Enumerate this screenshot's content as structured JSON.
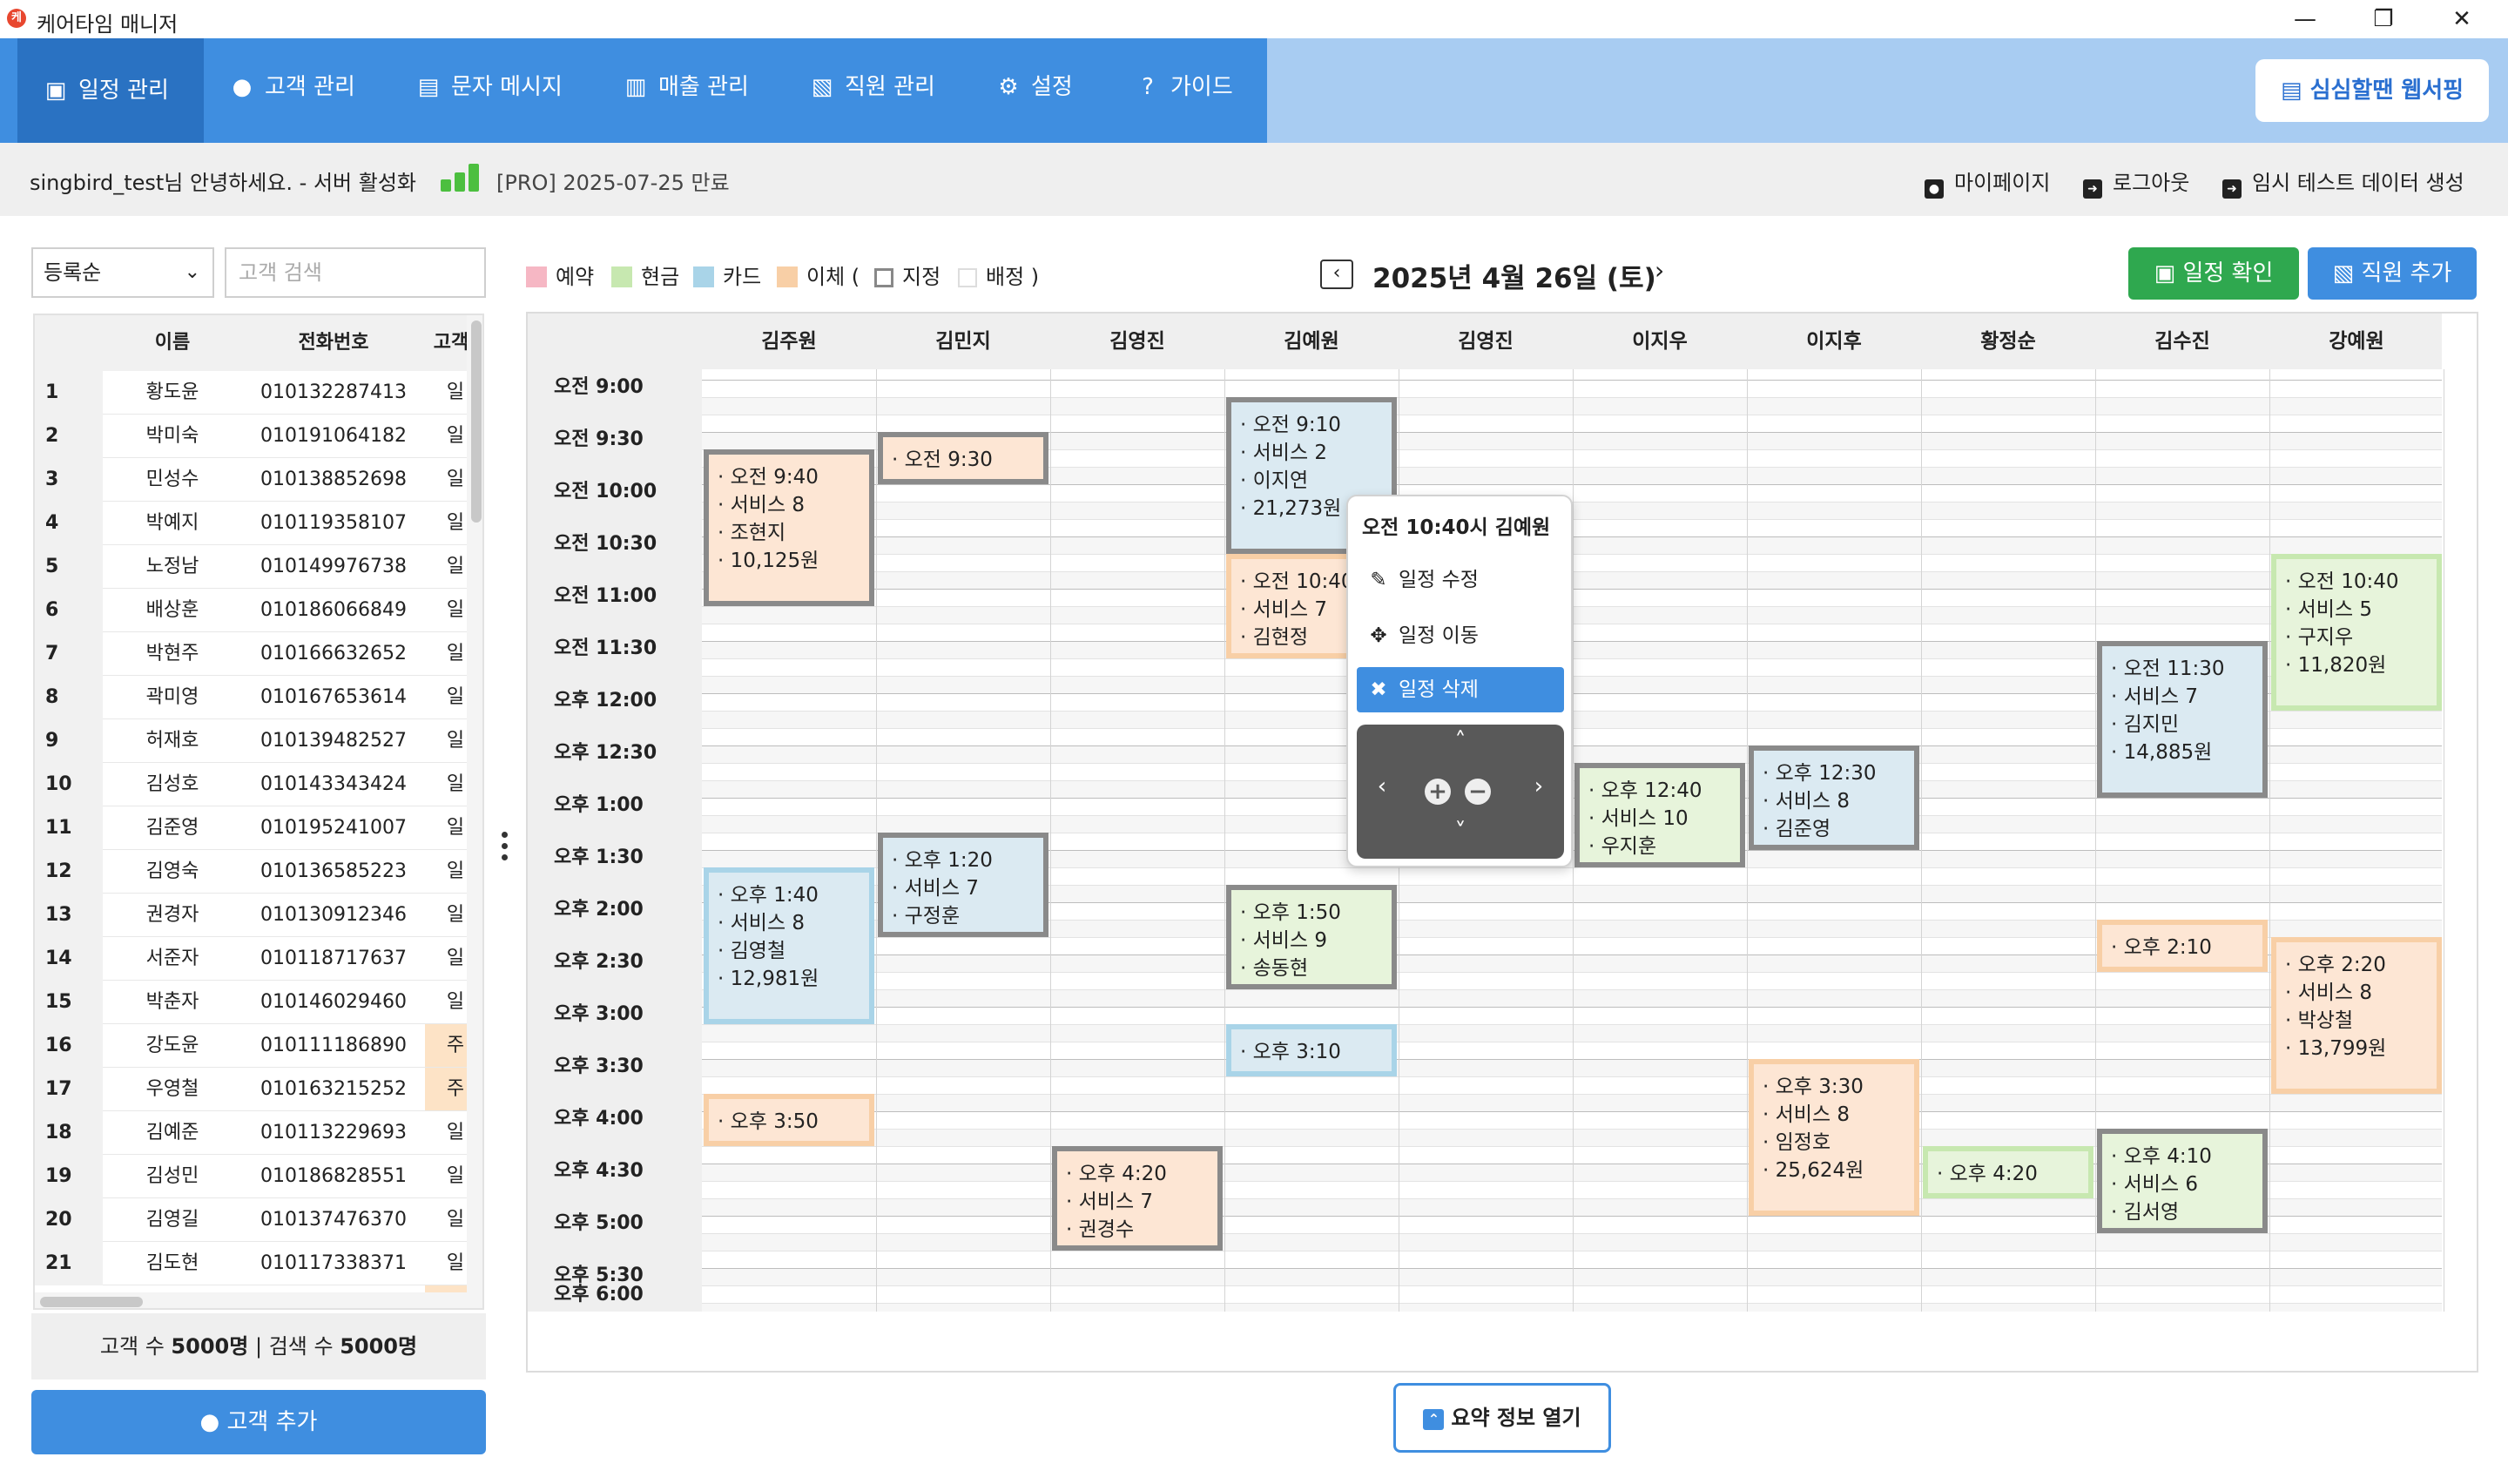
{
  "window": {
    "title": "케어타임 매니저",
    "logo": "케",
    "minimize": "—",
    "maximize": "❐",
    "close": "✕"
  },
  "nav": {
    "tabs": [
      {
        "label": "일정 관리",
        "icon": "calendar-icon",
        "glyph": "▣"
      },
      {
        "label": "고객 관리",
        "icon": "person-icon",
        "glyph": "👤"
      },
      {
        "label": "문자 메시지",
        "icon": "message-icon",
        "glyph": "▤"
      },
      {
        "label": "매출 관리",
        "icon": "document-icon",
        "glyph": "▥"
      },
      {
        "label": "직원 관리",
        "icon": "id-card-icon",
        "glyph": "▧"
      },
      {
        "label": "설정",
        "icon": "gear-icon",
        "glyph": "⚙"
      },
      {
        "label": "가이드",
        "icon": "question-icon",
        "glyph": "?"
      }
    ],
    "web_button": "심심할땐 웹서핑"
  },
  "status": {
    "greeting": "singbird_test님 안녕하세요. - 서버 활성화",
    "plan": "[PRO] 2025-07-25 만료",
    "mypage": "마이페이지",
    "logout": "로그아웃",
    "test_data": "임시 테스트 데이터 생성"
  },
  "customers": {
    "sort_value": "등록순",
    "search_placeholder": "고객 검색",
    "headers": {
      "name": "이름",
      "phone": "전화번호",
      "type": "고객"
    },
    "rows": [
      {
        "idx": "1",
        "name": "황도윤",
        "phone": "010132287413",
        "type": "일"
      },
      {
        "idx": "2",
        "name": "박미숙",
        "phone": "010191064182",
        "type": "일"
      },
      {
        "idx": "3",
        "name": "민성수",
        "phone": "010138852698",
        "type": "일"
      },
      {
        "idx": "4",
        "name": "박예지",
        "phone": "010119358107",
        "type": "일"
      },
      {
        "idx": "5",
        "name": "노정남",
        "phone": "010149976738",
        "type": "일"
      },
      {
        "idx": "6",
        "name": "배상훈",
        "phone": "010186066849",
        "type": "일"
      },
      {
        "idx": "7",
        "name": "박현주",
        "phone": "010166632652",
        "type": "일"
      },
      {
        "idx": "8",
        "name": "곽미영",
        "phone": "010167653614",
        "type": "일"
      },
      {
        "idx": "9",
        "name": "허재호",
        "phone": "010139482527",
        "type": "일"
      },
      {
        "idx": "10",
        "name": "김성호",
        "phone": "010143343424",
        "type": "일"
      },
      {
        "idx": "11",
        "name": "김준영",
        "phone": "010195241007",
        "type": "일"
      },
      {
        "idx": "12",
        "name": "김영숙",
        "phone": "010136585223",
        "type": "일"
      },
      {
        "idx": "13",
        "name": "권경자",
        "phone": "010130912346",
        "type": "일"
      },
      {
        "idx": "14",
        "name": "서준자",
        "phone": "010118717637",
        "type": "일"
      },
      {
        "idx": "15",
        "name": "박춘자",
        "phone": "010146029460",
        "type": "일"
      },
      {
        "idx": "16",
        "name": "강도윤",
        "phone": "010111186890",
        "type": "주"
      },
      {
        "idx": "17",
        "name": "우영철",
        "phone": "010163215252",
        "type": "주"
      },
      {
        "idx": "18",
        "name": "김예준",
        "phone": "010113229693",
        "type": "일"
      },
      {
        "idx": "19",
        "name": "김성민",
        "phone": "010186828551",
        "type": "일"
      },
      {
        "idx": "20",
        "name": "김영길",
        "phone": "010137476370",
        "type": "일"
      },
      {
        "idx": "21",
        "name": "김도현",
        "phone": "010117338371",
        "type": "일"
      }
    ],
    "footer_label_count": "고객 수",
    "footer_count": "5000명",
    "footer_sep": "|",
    "footer_label_search": "검색 수",
    "footer_search": "5000명",
    "add_button": "고객 추가"
  },
  "legend": {
    "reserve": "예약",
    "cash": "현금",
    "card": "카드",
    "transfer": "이체 (",
    "assigned": "지정",
    "distributed": "배정 )",
    "colors": {
      "reserve": "#f6b7c4",
      "cash": "#c7e8b0",
      "card": "#a9d4e8",
      "transfer": "#f8cfa6"
    }
  },
  "date": {
    "prev": "‹",
    "label": "2025년 4월 26일 (토)",
    "next": "›"
  },
  "buttons": {
    "confirm": "일정 확인",
    "add_staff": "직원 추가",
    "summary": "요약 정보 열기"
  },
  "schedule": {
    "staff": [
      "김주원",
      "김민지",
      "김영진",
      "김예원",
      "김영진",
      "이지우",
      "이지후",
      "황정순",
      "김수진",
      "강예원"
    ],
    "times": [
      "오전 9:00",
      "오전 9:30",
      "오전 10:00",
      "오전 10:30",
      "오전 11:00",
      "오전 11:30",
      "오후 12:00",
      "오후 12:30",
      "오후 1:00",
      "오후 1:30",
      "오후 2:00",
      "오후 2:30",
      "오후 3:00",
      "오후 3:30",
      "오후 4:00",
      "오후 4:30",
      "오후 5:00",
      "오후 5:30",
      "오후 6:00"
    ],
    "appointments": [
      {
        "col": 0,
        "start": 9.667,
        "end": 11.167,
        "pay": "transfer",
        "sel": true,
        "lines": [
          "오전 9:40",
          "서비스 8",
          "조현지",
          "10,125원"
        ]
      },
      {
        "col": 1,
        "start": 9.5,
        "end": 10.0,
        "pay": "transfer",
        "sel": true,
        "lines": [
          "오전 9:30"
        ]
      },
      {
        "col": 3,
        "start": 9.167,
        "end": 10.667,
        "pay": "card",
        "sel": true,
        "lines": [
          "오전 9:10",
          "서비스 2",
          "이지연",
          "21,273원"
        ]
      },
      {
        "col": 3,
        "start": 10.667,
        "end": 11.667,
        "pay": "transfer",
        "sel": false,
        "lines": [
          "오전 10:40",
          "서비스 7",
          "김현정"
        ]
      },
      {
        "col": 9,
        "start": 10.667,
        "end": 12.167,
        "pay": "cash",
        "sel": false,
        "lines": [
          "오전 10:40",
          "서비스 5",
          "구지우",
          "11,820원"
        ]
      },
      {
        "col": 8,
        "start": 11.5,
        "end": 13.0,
        "pay": "card",
        "sel": true,
        "lines": [
          "오전 11:30",
          "서비스 7",
          "김지민",
          "14,885원"
        ]
      },
      {
        "col": 5,
        "start": 12.667,
        "end": 13.667,
        "pay": "cash",
        "sel": true,
        "lines": [
          "오후 12:40",
          "서비스 10",
          "우지훈"
        ]
      },
      {
        "col": 6,
        "start": 12.5,
        "end": 13.5,
        "pay": "card",
        "sel": true,
        "lines": [
          "오후 12:30",
          "서비스 8",
          "김준영"
        ]
      },
      {
        "col": 0,
        "start": 13.667,
        "end": 15.167,
        "pay": "card",
        "sel": false,
        "lines": [
          "오후 1:40",
          "서비스 8",
          "김영철",
          "12,981원"
        ]
      },
      {
        "col": 1,
        "start": 13.333,
        "end": 14.333,
        "pay": "card",
        "sel": true,
        "lines": [
          "오후 1:20",
          "서비스 7",
          "구정훈"
        ]
      },
      {
        "col": 3,
        "start": 13.833,
        "end": 14.833,
        "pay": "cash",
        "sel": true,
        "lines": [
          "오후 1:50",
          "서비스 9",
          "송동현"
        ]
      },
      {
        "col": 8,
        "start": 14.167,
        "end": 14.667,
        "pay": "transfer",
        "sel": false,
        "lines": [
          "오후 2:10"
        ]
      },
      {
        "col": 9,
        "start": 14.333,
        "end": 15.833,
        "pay": "transfer",
        "sel": false,
        "lines": [
          "오후 2:20",
          "서비스 8",
          "박상철",
          "13,799원"
        ]
      },
      {
        "col": 3,
        "start": 15.167,
        "end": 15.667,
        "pay": "card",
        "sel": false,
        "lines": [
          "오후 3:10"
        ]
      },
      {
        "col": 0,
        "start": 15.833,
        "end": 16.333,
        "pay": "transfer",
        "sel": false,
        "lines": [
          "오후 3:50"
        ]
      },
      {
        "col": 6,
        "start": 15.5,
        "end": 17.0,
        "pay": "transfer",
        "sel": false,
        "lines": [
          "오후 3:30",
          "서비스 8",
          "임정호",
          "25,624원"
        ]
      },
      {
        "col": 2,
        "start": 16.333,
        "end": 17.333,
        "pay": "transfer",
        "sel": true,
        "lines": [
          "오후 4:20",
          "서비스 7",
          "권경수"
        ]
      },
      {
        "col": 7,
        "start": 16.333,
        "end": 16.833,
        "pay": "cash",
        "sel": false,
        "lines": [
          "오후 4:20"
        ]
      },
      {
        "col": 8,
        "start": 16.167,
        "end": 17.167,
        "pay": "cash",
        "sel": true,
        "lines": [
          "오후 4:10",
          "서비스 6",
          "김서영"
        ]
      }
    ]
  },
  "context_menu": {
    "title": "오전 10:40시 김예원",
    "edit": "일정 수정",
    "move": "일정 이동",
    "delete": "일정 삭제"
  }
}
